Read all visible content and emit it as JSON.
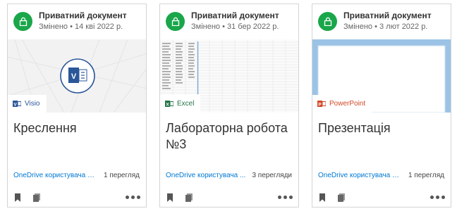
{
  "cards": [
    {
      "privacy": "Приватний документ",
      "modified": "Змінено • 14 кві 2022 р.",
      "app": "Visio",
      "title": "Креслення",
      "owner": "OneDrive користувача В...",
      "views": "1 перегляд"
    },
    {
      "privacy": "Приватний документ",
      "modified": "Змінено • 31 бер 2022 р.",
      "app": "Excel",
      "title": "Лабораторна робота №3",
      "owner": "OneDrive користувача ...",
      "views": "3 перегляди"
    },
    {
      "privacy": "Приватний документ",
      "modified": "Змінено • 3 лют 2022 р.",
      "app": "PowerPoint",
      "title": "Презентація",
      "owner": "OneDrive користувача В...",
      "views": "1 перегляд"
    }
  ],
  "colors": {
    "lock_green": "#1aa64a",
    "link_blue": "#0078d4",
    "visio_blue": "#2b579a",
    "excel_green": "#217346",
    "ppt_orange": "#d24726",
    "ppt_slide_bg": "#9cc3e6"
  },
  "icons": {
    "privacy": "lock-icon",
    "bookmark": "bookmark-icon",
    "copies": "copies-icon",
    "more": "more-options-icon"
  }
}
